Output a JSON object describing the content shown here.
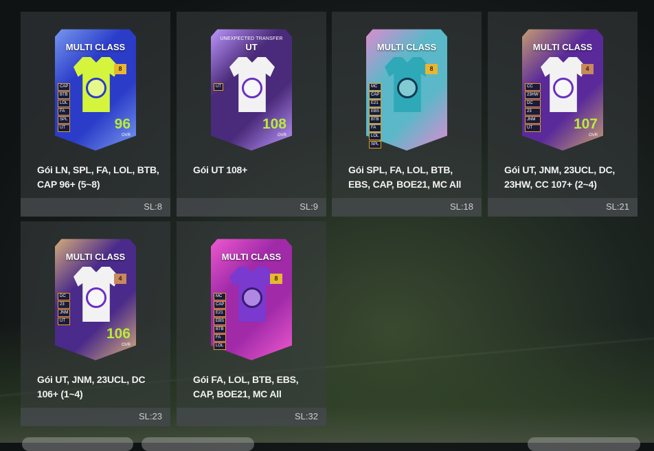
{
  "packs": [
    {
      "title": "Gói LN, SPL, FA, LOL, BTB, CAP 96+ (5~8)",
      "qty": "SL:8",
      "card": {
        "label": "MULTI CLASS",
        "sub": "",
        "badge": "8",
        "badge_type": "gold",
        "tags": [
          "CAP",
          "BTB",
          "LOL",
          "FA",
          "SPL",
          "UT"
        ],
        "ovr": "96",
        "ovr_label": "OVR",
        "bg": "#2a3cc8",
        "accent": "#7a9af0",
        "jersey": "#d4f53c",
        "crest": "#2a3cc8"
      }
    },
    {
      "title": "Gói UT 108+",
      "qty": "SL:9",
      "card": {
        "label": "UT",
        "sub": "UNEXPECTED TRANSFER",
        "badge": "",
        "badge_type": "",
        "tags": [
          "UT"
        ],
        "ovr": "108",
        "ovr_label": "OVR",
        "bg": "#4a2a7a",
        "accent": "#c09aff",
        "jersey": "#f2f2f2",
        "crest": "#6a2fc2"
      }
    },
    {
      "title": "Gói SPL, FA, LOL, BTB, EBS, CAP, BOE21, MC All",
      "qty": "SL:18",
      "card": {
        "label": "MULTI CLASS",
        "sub": "",
        "badge": "8",
        "badge_type": "gold",
        "tags": [
          "MC",
          "CAP",
          "E21",
          "EBS",
          "BTB",
          "FA",
          "LOL",
          "SPL"
        ],
        "ovr": "",
        "ovr_label": "",
        "bg": "#5ab8c8",
        "accent": "#e08ad0",
        "jersey": "#2fa8b8",
        "crest": "#0a3a50"
      }
    },
    {
      "title": "Gói UT, JNM, 23UCL, DC, 23HW, CC 107+ (2~4)",
      "qty": "SL:21",
      "card": {
        "label": "MULTI CLASS",
        "sub": "",
        "badge": "4",
        "badge_type": "bronze",
        "tags": [
          "CC",
          "23HW",
          "DC",
          "23",
          "JNM",
          "UT"
        ],
        "ovr": "107",
        "ovr_label": "OVR",
        "bg": "#5a2a9a",
        "accent": "#c8a070",
        "jersey": "#f2f2f2",
        "crest": "#6a2fc2"
      }
    },
    {
      "title": "Gói UT, JNM, 23UCL, DC 106+ (1~4)",
      "qty": "SL:23",
      "card": {
        "label": "MULTI CLASS",
        "sub": "",
        "badge": "4",
        "badge_type": "bronze",
        "tags": [
          "DC",
          "23",
          "JNM",
          "UT"
        ],
        "ovr": "106",
        "ovr_label": "OVR",
        "bg": "#4a2a8a",
        "accent": "#d8b07a",
        "jersey": "#f2f2f2",
        "crest": "#6a2fc2"
      }
    },
    {
      "title": "Gói FA, LOL, BTB, EBS, CAP, BOE21, MC All",
      "qty": "SL:32",
      "card": {
        "label": "MULTI CLASS",
        "sub": "",
        "badge": "8",
        "badge_type": "gold",
        "tags": [
          "MC",
          "CAP",
          "E21",
          "EBS",
          "BTB",
          "FA",
          "LOL"
        ],
        "ovr": "",
        "ovr_label": "",
        "bg": "#a02aa8",
        "accent": "#f05ad0",
        "jersey": "#7a3ad0",
        "crest": "#3a1a70"
      }
    }
  ]
}
